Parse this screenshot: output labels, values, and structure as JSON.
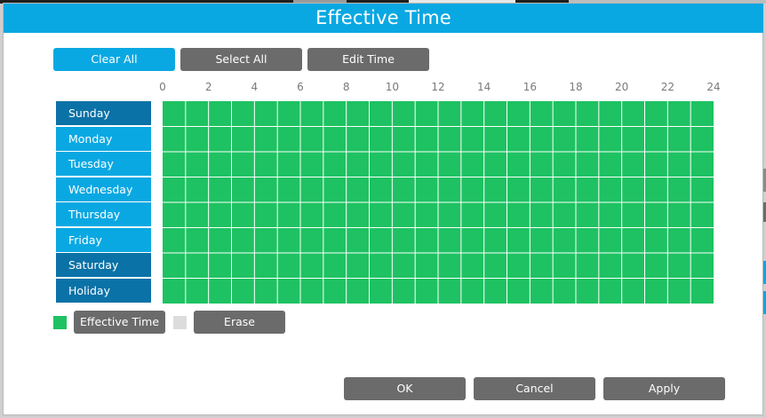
{
  "dialog": {
    "title": "Effective Time"
  },
  "toolbar": {
    "clear_all": "Clear All",
    "select_all": "Select All",
    "edit_time": "Edit Time"
  },
  "hours": [
    "0",
    "2",
    "4",
    "6",
    "8",
    "10",
    "12",
    "14",
    "16",
    "18",
    "20",
    "22",
    "24"
  ],
  "days": [
    "Sunday",
    "Monday",
    "Tuesday",
    "Wednesday",
    "Thursday",
    "Friday",
    "Saturday",
    "Holiday"
  ],
  "schedule": {
    "columns": 24,
    "rows": 8,
    "selected_fraction": 1.0,
    "selected_color": "#1ec262"
  },
  "legend": {
    "effective_time": "Effective Time",
    "erase": "Erase",
    "effective_color": "#1ec262",
    "erase_color": "#dcdcdc"
  },
  "footer": {
    "ok": "OK",
    "cancel": "Cancel",
    "apply": "Apply"
  },
  "colors": {
    "accent": "#0aa8e2",
    "accent_dark": "#0a72a7",
    "button_gray": "#6b6b6b"
  }
}
